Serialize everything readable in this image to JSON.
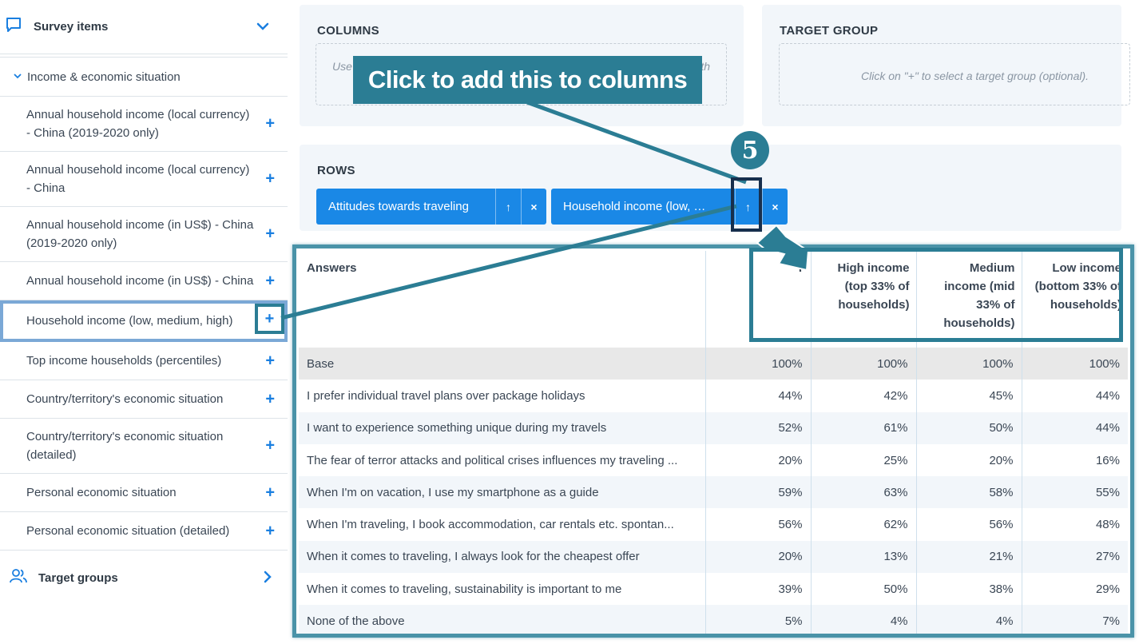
{
  "sidebar": {
    "header_title": "Survey items",
    "section_title": "Income & economic situation",
    "items": [
      {
        "label": "Annual household income (local currency) - China (2019-2020 only)"
      },
      {
        "label": "Annual household income (local currency) - China"
      },
      {
        "label": "Annual household income (in US$) - China (2019-2020 only)"
      },
      {
        "label": "Annual household income (in US$) - China"
      },
      {
        "label": "Household income (low, medium, high)"
      },
      {
        "label": "Top income households (percentiles)"
      },
      {
        "label": "Country/territory's economic situation"
      },
      {
        "label": "Country/territory's economic situation (detailed)"
      },
      {
        "label": "Personal economic situation"
      },
      {
        "label": "Personal economic situation (detailed)"
      }
    ],
    "plus_glyph": "+",
    "target_groups_label": "Target groups"
  },
  "columns_panel": {
    "title": "COLUMNS",
    "placeholder_left": "Use",
    "placeholder_right": "th"
  },
  "target_panel": {
    "title": "TARGET GROUP",
    "placeholder": "Click on \"+\" to select a target group (optional)."
  },
  "rows_panel": {
    "title": "ROWS",
    "chips": [
      {
        "label": "Attitudes towards traveling",
        "up": "↑",
        "remove": "×"
      },
      {
        "label": "Household income (low, …",
        "up": "↑",
        "remove": "×"
      }
    ]
  },
  "table": {
    "headers": [
      "Answers",
      "T",
      "High income (top 33% of households)",
      "Medium income (mid 33% of households)",
      "Low income (bottom 33% of households)"
    ],
    "rows": [
      {
        "answer": "Base",
        "values": [
          "100%",
          "100%",
          "100%",
          "100%"
        ]
      },
      {
        "answer": "I prefer individual travel plans over package holidays",
        "values": [
          "44%",
          "42%",
          "45%",
          "44%"
        ]
      },
      {
        "answer": "I want to experience something unique during my travels",
        "values": [
          "52%",
          "61%",
          "50%",
          "44%"
        ]
      },
      {
        "answer": "The fear of terror attacks and political crises influences my traveling ...",
        "values": [
          "20%",
          "25%",
          "20%",
          "16%"
        ]
      },
      {
        "answer": "When I'm on vacation, I use my smartphone as a guide",
        "values": [
          "59%",
          "63%",
          "58%",
          "55%"
        ]
      },
      {
        "answer": "When I'm traveling, I book accommodation, car rentals etc. spontan...",
        "values": [
          "56%",
          "62%",
          "56%",
          "48%"
        ]
      },
      {
        "answer": "When it comes to traveling, I always look for the cheapest offer",
        "values": [
          "20%",
          "13%",
          "21%",
          "27%"
        ]
      },
      {
        "answer": "When it comes to traveling, sustainability is important to me",
        "values": [
          "39%",
          "50%",
          "38%",
          "29%"
        ]
      },
      {
        "answer": "None of the above",
        "values": [
          "5%",
          "4%",
          "4%",
          "7%"
        ]
      }
    ]
  },
  "annotation": {
    "callout": "Click to add this to columns",
    "step_number": "5"
  },
  "colors": {
    "accent": "#1a88e6",
    "annotation": "#2b7d94",
    "panel_bg": "#f2f6fa"
  }
}
